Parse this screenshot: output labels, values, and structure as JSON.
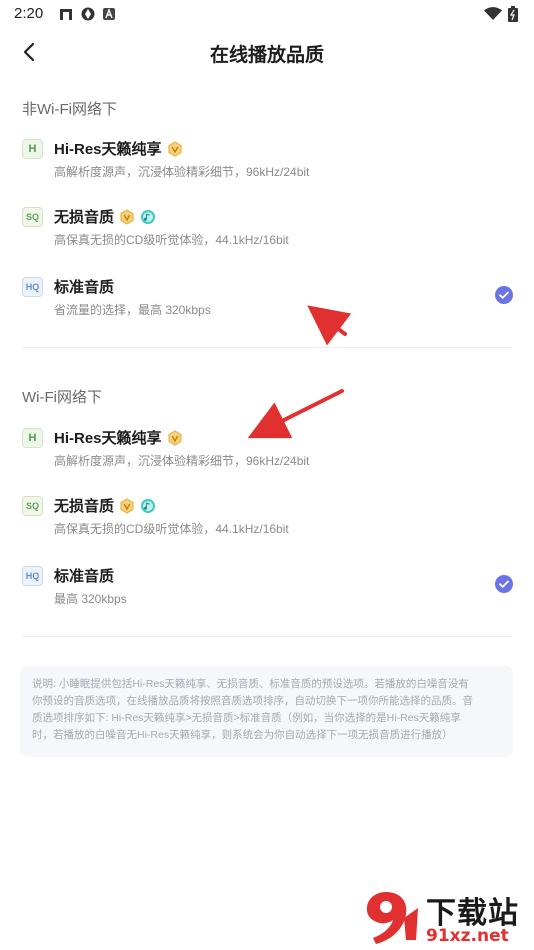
{
  "status_bar": {
    "time": "2:20"
  },
  "header": {
    "title": "在线播放品质"
  },
  "sections": [
    {
      "title": "非Wi-Fi网络下",
      "options": [
        {
          "badge": "H",
          "title": "Hi-Res天籁纯享",
          "subtitle": "高解析度源声，沉浸体验精彩细节，96kHz/24bit",
          "selected": false
        },
        {
          "badge": "SQ",
          "title": "无损音质",
          "subtitle": "高保真无损的CD级听觉体验，44.1kHz/16bit",
          "selected": false
        },
        {
          "badge": "HQ",
          "title": "标准音质",
          "subtitle": "省流量的选择，最高 320kbps",
          "selected": true
        }
      ]
    },
    {
      "title": "Wi-Fi网络下",
      "options": [
        {
          "badge": "H",
          "title": "Hi-Res天籁纯享",
          "subtitle": "高解析度源声，沉浸体验精彩细节，96kHz/24bit",
          "selected": false
        },
        {
          "badge": "SQ",
          "title": "无损音质",
          "subtitle": "高保真无损的CD级听觉体验，44.1kHz/16bit",
          "selected": false
        },
        {
          "badge": "HQ",
          "title": "标准音质",
          "subtitle": "最高 320kbps",
          "selected": true
        }
      ]
    }
  ],
  "note": {
    "line1": "说明: 小睡眠提供包括Hi-Res天籁纯享、无损音质、标准音质的预设选项。若播放的白噪音没有",
    "line2": "你预设的音质选项，在线播放品质将按照音质选项排序，自动切换下一项你所能选择的品质。音",
    "line3": "质选项排序如下: Hi-Res天籁纯享>无损音质>标准音质（例如，当你选择的是Hi-Res天籁纯享",
    "line4": "时，若播放的白噪音无Hi-Res天籁纯享，则系统会为你自动选择下一项无损音质进行播放）"
  },
  "watermark": {
    "title": "下载站",
    "url": "91xz.net"
  },
  "colors": {
    "accent": "#6b74e6",
    "vip_gold": "#f2b73a",
    "music_teal": "#3fc9c1",
    "arrow_red": "#e0302f"
  }
}
